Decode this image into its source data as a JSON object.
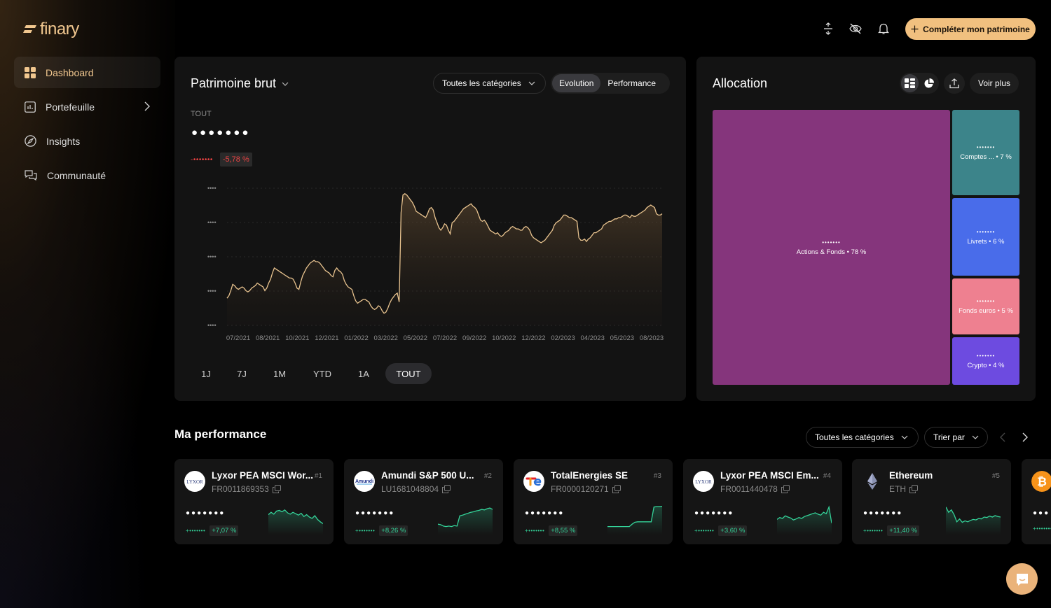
{
  "brand": {
    "name": "finary",
    "accent": "#f1c78f"
  },
  "sidebar": {
    "items": [
      {
        "label": "Dashboard",
        "icon": "dashboard-grid-icon",
        "active": true
      },
      {
        "label": "Portefeuille",
        "icon": "chart-bars-icon",
        "has_submenu": true
      },
      {
        "label": "Insights",
        "icon": "compass-icon"
      },
      {
        "label": "Communauté",
        "icon": "chat-bubbles-icon"
      }
    ]
  },
  "topbar": {
    "icons": [
      "expand-vertical-icon",
      "eye-off-icon",
      "bell-icon"
    ],
    "cta_label": "Compléter mon patrimoine"
  },
  "patrimoine": {
    "title": "Patrimoine brut",
    "category_filter": "Toutes les catégories",
    "view_tabs": [
      {
        "label": "Evolution",
        "active": true
      },
      {
        "label": "Performance",
        "active": false
      }
    ],
    "period_label": "TOUT",
    "masked_value": "●●●●●●●",
    "change_masked": "-•••••••",
    "change_pct": "-5,78 %",
    "range_tabs": [
      {
        "label": "1J"
      },
      {
        "label": "7J"
      },
      {
        "label": "1M"
      },
      {
        "label": "YTD"
      },
      {
        "label": "1A"
      },
      {
        "label": "TOUT",
        "active": true
      }
    ]
  },
  "chart_data": {
    "type": "area",
    "title": "Patrimoine brut",
    "xlabel": "",
    "ylabel": "",
    "y_tick_labels": [
      "••••",
      "••••",
      "••••",
      "••••",
      "••••"
    ],
    "x_tick_labels": [
      "07/2021",
      "08/2021",
      "10/2021",
      "12/2021",
      "01/2022",
      "03/2022",
      "05/2022",
      "07/2022",
      "09/2022",
      "10/2022",
      "12/2022",
      "02/2023",
      "04/2023",
      "05/2023",
      "08/2023"
    ],
    "ylim": [
      0,
      100
    ],
    "grid": true,
    "line_color": "#e8c38f",
    "values": [
      16,
      18,
      22,
      27,
      26,
      24,
      23,
      24,
      25,
      24,
      22,
      21,
      22,
      24,
      25,
      26,
      28,
      27,
      26,
      25,
      22,
      24,
      28,
      31,
      36,
      40,
      39,
      38,
      37,
      36,
      35,
      34,
      33,
      32,
      32,
      31,
      28,
      24,
      23,
      29,
      34,
      37,
      40,
      42,
      44,
      45,
      46,
      45,
      45,
      44,
      42,
      40,
      38,
      37,
      36,
      34,
      33,
      38,
      40,
      38,
      37,
      35,
      30,
      27,
      25,
      24,
      23,
      18,
      14,
      12,
      13,
      14,
      15,
      15,
      14,
      13,
      10,
      8,
      7,
      8,
      10,
      9,
      6,
      4,
      5,
      8,
      12,
      15,
      17,
      19,
      20,
      13,
      84,
      98,
      99,
      98,
      96,
      94,
      92,
      89,
      85,
      84,
      83,
      82,
      81,
      80,
      83,
      87,
      88,
      86,
      80,
      76,
      72,
      70,
      72,
      75,
      74,
      70,
      67,
      76,
      77,
      79,
      81,
      83,
      85,
      87,
      88,
      89,
      90,
      91,
      89,
      88,
      86,
      82,
      78,
      77,
      78,
      76,
      73,
      70,
      69,
      68,
      67,
      68,
      66,
      65,
      66,
      68,
      69,
      70,
      72,
      73,
      72,
      71,
      71,
      70,
      70,
      72,
      73,
      72,
      70,
      66,
      64,
      63,
      62,
      61,
      60,
      61,
      62,
      64,
      66,
      68,
      70,
      74,
      76,
      77,
      78,
      80,
      82,
      82,
      81,
      80,
      80,
      79,
      78,
      77,
      64,
      62,
      62,
      63,
      61,
      63,
      64,
      66,
      68,
      68,
      69,
      70,
      71,
      74,
      75,
      76,
      77,
      77,
      78,
      79,
      79,
      80,
      80,
      81,
      82,
      82,
      81,
      80,
      82,
      81,
      81,
      82,
      83,
      84,
      85,
      86,
      88,
      89,
      90,
      89,
      88,
      83,
      82,
      82,
      83
    ]
  },
  "allocation": {
    "title": "Allocation",
    "view_toggle": [
      {
        "icon": "treemap-icon",
        "active": true
      },
      {
        "icon": "pie-chart-icon",
        "active": false
      }
    ],
    "share_icon": "share-upload-icon",
    "more_label": "Voir plus",
    "tiles": [
      {
        "label": "Actions & Fonds",
        "pct": "78 %",
        "masked": "•••••••",
        "color": "#85357c"
      },
      {
        "label": "Comptes ...",
        "pct": "7 %",
        "masked": "•••••••",
        "color": "#3c848a"
      },
      {
        "label": "Livrets",
        "pct": "6 %",
        "masked": "•••••••",
        "color": "#496cea"
      },
      {
        "label": "Fonds euros",
        "pct": "5 %",
        "masked": "•••••••",
        "color": "#ee8090"
      },
      {
        "label": "Crypto",
        "pct": "4 %",
        "masked": "•••••••",
        "color": "#6d4be0"
      }
    ]
  },
  "performance": {
    "title": "Ma performance",
    "category_filter": "Toutes les catégories",
    "sort_label": "Trier par",
    "positive_color": "#34d399",
    "cards": [
      {
        "name": "Lyxor PEA MSCI Wor...",
        "rank": "#1",
        "code": "FR0011869353",
        "logo": "lyxor-logo",
        "masked_value": "●●●●●●●",
        "change_masked": "+•••••••",
        "change_pct": "+7,07 %",
        "spark": [
          60,
          70,
          62,
          75,
          78,
          72,
          80,
          68,
          62,
          70,
          64,
          58,
          66,
          52,
          60,
          50,
          44,
          56,
          40,
          30,
          22
        ]
      },
      {
        "name": "Amundi S&P 500 U...",
        "rank": "#2",
        "code": "LU1681048804",
        "logo": "amundi-logo",
        "masked_value": "●●●●●●●",
        "change_masked": "+•••••••",
        "change_pct": "+8,26 %",
        "spark": [
          20,
          18,
          12,
          10,
          12,
          10,
          14,
          12,
          55,
          58,
          62,
          66,
          70,
          72,
          76,
          78,
          82,
          80,
          85,
          88,
          82
        ]
      },
      {
        "name": "TotalEnergies SE",
        "rank": "#3",
        "code": "FR0000120271",
        "logo": "totalenergies-logo",
        "masked_value": "●●●●●●●",
        "change_masked": "+•••••••",
        "change_pct": "+8,55 %",
        "spark": [
          10,
          10,
          10,
          10,
          10,
          10,
          10,
          10,
          10,
          20,
          28,
          30,
          30,
          30,
          30,
          30,
          30,
          92,
          94,
          94,
          95
        ]
      },
      {
        "name": "Lyxor PEA MSCI Em...",
        "rank": "#4",
        "code": "FR0011440478",
        "logo": "lyxor-logo",
        "masked_value": "●●●●●●●",
        "change_masked": "+•••••••",
        "change_pct": "+3,60 %",
        "spark": [
          40,
          48,
          44,
          55,
          50,
          46,
          38,
          42,
          48,
          44,
          52,
          56,
          60,
          64,
          68,
          62,
          58,
          70,
          64,
          92,
          24
        ]
      },
      {
        "name": "Ethereum",
        "rank": "#5",
        "code": "ETH",
        "logo": "ethereum-logo",
        "masked_value": "●●●●●●●",
        "change_masked": "+•••••••",
        "change_pct": "+11,40 %",
        "spark": [
          92,
          70,
          80,
          60,
          30,
          42,
          28,
          34,
          30,
          36,
          40,
          38,
          44,
          42,
          50,
          48,
          54,
          50,
          56,
          52,
          50
        ]
      },
      {
        "name": "",
        "rank": "",
        "code": "",
        "logo": "bitcoin-logo",
        "masked_value": "●●●",
        "change_masked": "+•••••••",
        "change_pct": "",
        "partial": true
      }
    ]
  }
}
